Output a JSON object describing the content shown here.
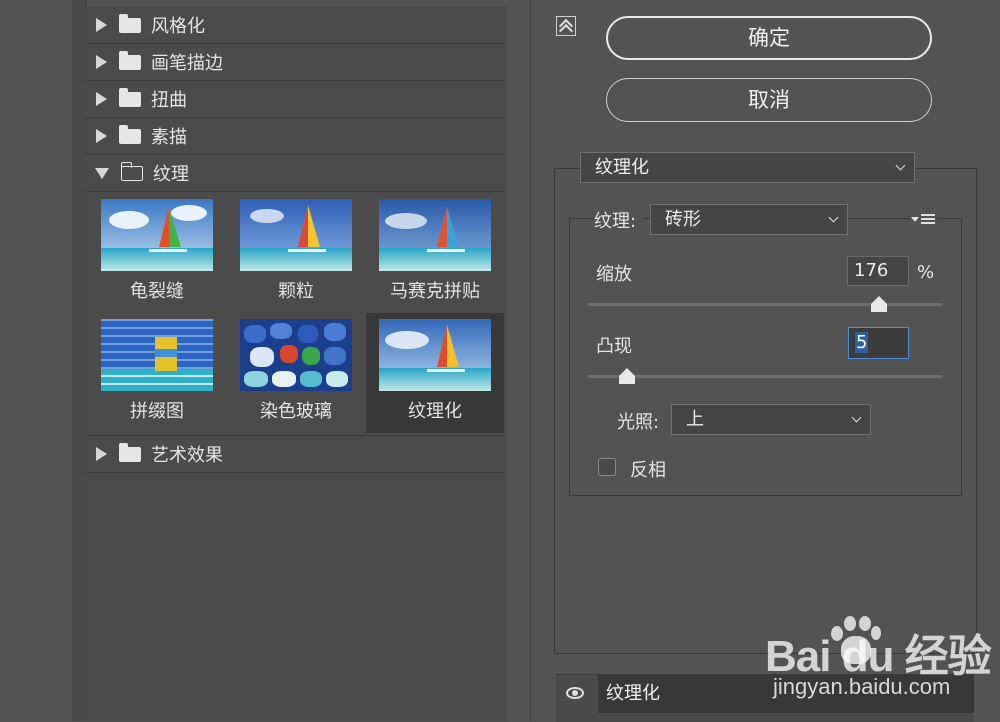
{
  "filter_tree": {
    "categories": [
      {
        "label": "风格化",
        "expanded": false
      },
      {
        "label": "画笔描边",
        "expanded": false
      },
      {
        "label": "扭曲",
        "expanded": false
      },
      {
        "label": "素描",
        "expanded": false
      },
      {
        "label": "纹理",
        "expanded": true
      },
      {
        "label": "艺术效果",
        "expanded": false
      }
    ],
    "texture_filters": [
      {
        "label": "龟裂缝",
        "selected": false
      },
      {
        "label": "颗粒",
        "selected": false
      },
      {
        "label": "马赛克拼贴",
        "selected": false
      },
      {
        "label": "拼缀图",
        "selected": false
      },
      {
        "label": "染色玻璃",
        "selected": false
      },
      {
        "label": "纹理化",
        "selected": true
      }
    ]
  },
  "buttons": {
    "ok": "确定",
    "cancel": "取消"
  },
  "settings": {
    "filter_select": "纹理化",
    "texture_label": "纹理:",
    "texture_value": "砖形",
    "scaling_label": "缩放",
    "scaling_value": "176",
    "scaling_unit": "%",
    "scaling_slider_fraction": 0.82,
    "relief_label": "凸现",
    "relief_value": "5",
    "relief_slider_fraction": 0.11,
    "light_label": "光照:",
    "light_value": "上",
    "invert_label": "反相",
    "invert_checked": false
  },
  "layers": {
    "active_layer": "纹理化"
  },
  "watermark": {
    "brand": "Bai   du 经验",
    "url": "jingyan.baidu.com"
  },
  "colors": {
    "background": "#535353",
    "selection": "#383838",
    "focus": "#4c8fd6"
  }
}
